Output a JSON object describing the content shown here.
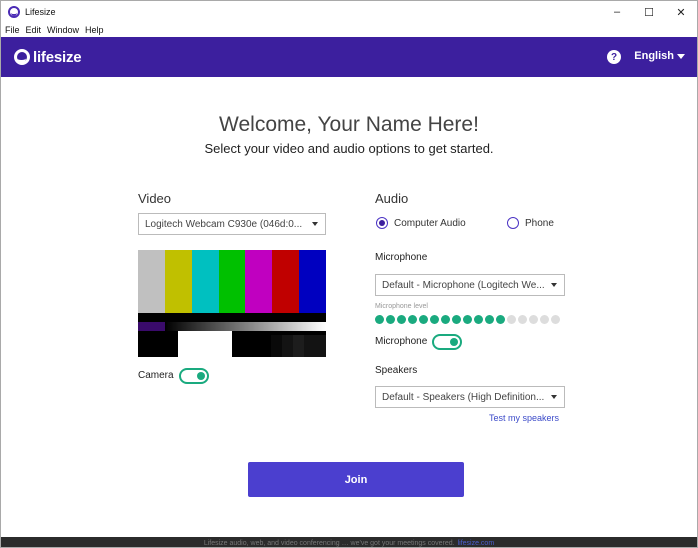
{
  "window": {
    "title": "Lifesize",
    "minimize": "–",
    "maximize": "☐",
    "close": "✕"
  },
  "menu": [
    "File",
    "Edit",
    "Window",
    "Help"
  ],
  "header": {
    "logo_text": "lifesize",
    "help_icon": "?",
    "language": "English"
  },
  "main": {
    "welcome": "Welcome, Your Name Here!",
    "subtitle": "Select your video and audio options to get started."
  },
  "video": {
    "label": "Video",
    "camera_select": "Logitech Webcam C930e (046d:0...",
    "camera_toggle_label": "Camera",
    "camera_on": true,
    "color_bars": [
      "#c0c0c0",
      "#c0c000",
      "#00c0c0",
      "#00c000",
      "#c000c0",
      "#c00000",
      "#0000c0"
    ],
    "mid_strip": [
      "#0000c0",
      "#131313",
      "#c000c0",
      "#131313",
      "#00c0c0",
      "#131313",
      "#c0c0c0"
    ],
    "pluge": [
      "#090909",
      "#131313",
      "#1d1d1d",
      "#131313",
      "#131313"
    ]
  },
  "audio": {
    "label": "Audio",
    "option_computer": "Computer Audio",
    "option_phone": "Phone",
    "selected": "computer",
    "microphone_title": "Microphone",
    "microphone_select": "Default - Microphone (Logitech We...",
    "microphone_level_label": "Microphone level",
    "microphone_level": 0.71,
    "microphone_level_dots": 17,
    "microphone_toggle_label": "Microphone",
    "microphone_on": true,
    "speakers_title": "Speakers",
    "speakers_select": "Default - Speakers (High Definition...",
    "test_speakers": "Test my speakers"
  },
  "join_label": "Join",
  "footer": {
    "text": "Lifesize audio, web, and video conferencing … we've got your meetings covered.",
    "link": "lifesize.com"
  },
  "colors": {
    "brand": "#3c1f9e",
    "accent_green": "#1aaa7f",
    "join_button": "#4b3fcf"
  }
}
